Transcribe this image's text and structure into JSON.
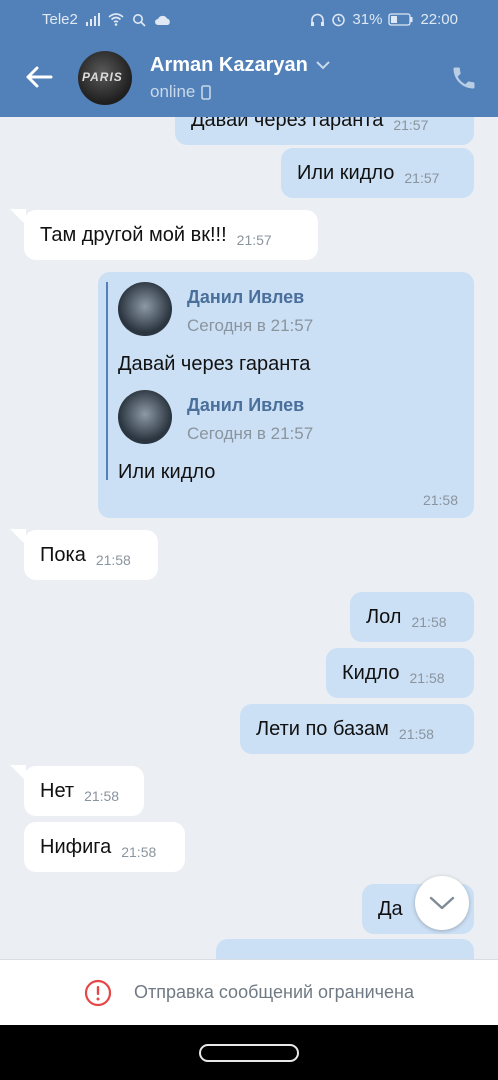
{
  "status_bar": {
    "carrier": "Tele2",
    "battery": "31%",
    "time": "22:00"
  },
  "header": {
    "contact_name": "Arman Kazaryan",
    "status": "online",
    "avatar_text": "PARIS"
  },
  "messages": [
    {
      "text": "Давай через гаранта",
      "time": "21:57",
      "dir": "out"
    },
    {
      "text": "Или кидло",
      "time": "21:57",
      "dir": "out"
    },
    {
      "text": "Там другой мой вк!!!",
      "time": "21:57",
      "dir": "in"
    },
    {
      "text": "Пока",
      "time": "21:58",
      "dir": "in"
    },
    {
      "text": "Лол",
      "time": "21:58",
      "dir": "out"
    },
    {
      "text": "Кидло",
      "time": "21:58",
      "dir": "out"
    },
    {
      "text": "Лети по базам",
      "time": "21:58",
      "dir": "out"
    },
    {
      "text": "Нет",
      "time": "21:58",
      "dir": "in"
    },
    {
      "text": "Нифига",
      "time": "21:58",
      "dir": "in"
    },
    {
      "text": "Да",
      "time": "",
      "dir": "out"
    }
  ],
  "forwarded": {
    "time": "21:58",
    "items": [
      {
        "author": "Данил Ивлев",
        "date": "Сегодня в 21:57",
        "text": "Давай через гаранта"
      },
      {
        "author": "Данил Ивлев",
        "date": "Сегодня в 21:57",
        "text": "Или кидло"
      }
    ]
  },
  "footer": {
    "notice": "Отправка сообщений ограничена"
  },
  "colors": {
    "header": "#5181b8",
    "outgoing": "#cce0f5",
    "incoming": "#ffffff",
    "background": "#ebeef2",
    "notice_icon": "#e64646"
  },
  "icons": [
    "back-arrow-icon",
    "chevron-down-icon",
    "mobile-icon",
    "phone-icon",
    "scroll-down-icon",
    "warning-icon"
  ]
}
